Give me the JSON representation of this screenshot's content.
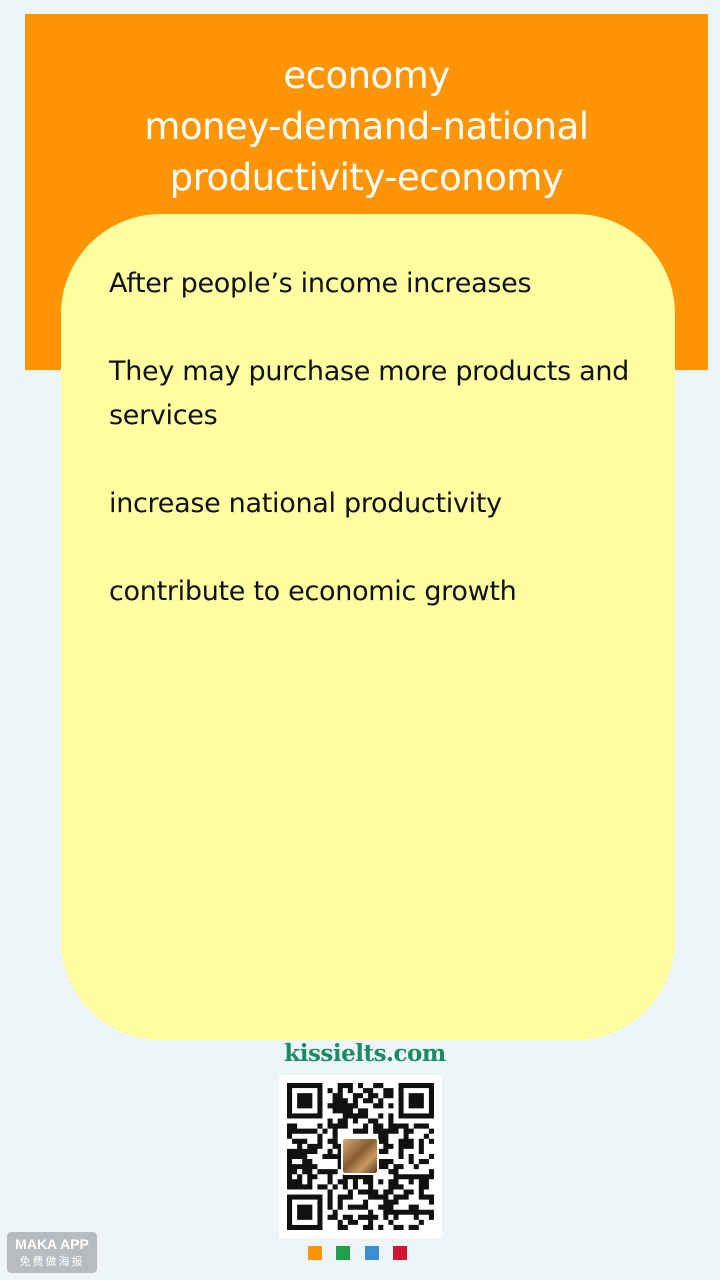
{
  "header": {
    "title_lines": [
      "economy",
      "money-demand-national",
      "productivity-economy"
    ],
    "bg_color": "#ff9505"
  },
  "card": {
    "bg_color": "#fffea1",
    "paragraphs": [
      "After people’s income increases",
      "They may purchase  more products and services",
      "increase national productivity",
      "contribute to economic growth"
    ]
  },
  "footer": {
    "site": "kissielts.com",
    "qr_icon": "qr-code-icon",
    "badge_title": "MAKA APP",
    "badge_subtitle": "免费做海报",
    "dots": [
      {
        "name": "orange-dot",
        "color": "#ff9505"
      },
      {
        "name": "green-dot",
        "color": "#20a04a"
      },
      {
        "name": "blue-dot",
        "color": "#3b8ed0"
      },
      {
        "name": "red-dot",
        "color": "#d31532"
      }
    ]
  }
}
